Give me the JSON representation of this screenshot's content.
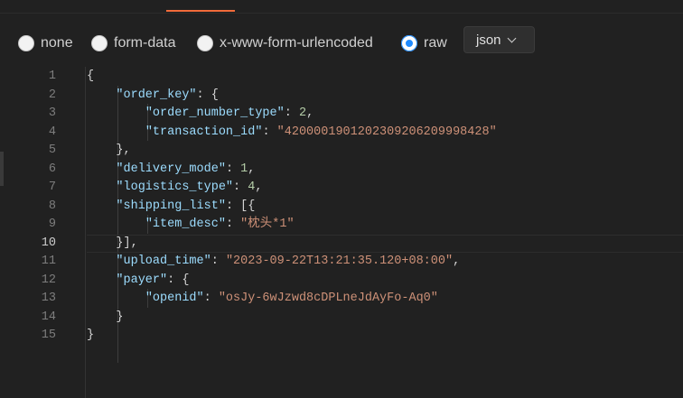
{
  "body_modes": {
    "options": [
      {
        "label": "none",
        "selected": false
      },
      {
        "label": "form-data",
        "selected": false
      },
      {
        "label": "x-www-form-urlencoded",
        "selected": false
      },
      {
        "label": "raw",
        "selected": true
      }
    ],
    "format_select": {
      "value": "json",
      "icon": "chevron-down-icon"
    }
  },
  "editor": {
    "active_line": 10,
    "lines": [
      {
        "no": "1",
        "tokens": [
          {
            "t": "p",
            "v": "{"
          }
        ]
      },
      {
        "no": "2",
        "tokens": [
          {
            "t": "p",
            "v": "    "
          },
          {
            "t": "k",
            "v": "\"order_key\""
          },
          {
            "t": "p",
            "v": ": {"
          }
        ]
      },
      {
        "no": "3",
        "tokens": [
          {
            "t": "p",
            "v": "        "
          },
          {
            "t": "k",
            "v": "\"order_number_type\""
          },
          {
            "t": "p",
            "v": ": "
          },
          {
            "t": "n",
            "v": "2"
          },
          {
            "t": "p",
            "v": ","
          }
        ]
      },
      {
        "no": "4",
        "tokens": [
          {
            "t": "p",
            "v": "        "
          },
          {
            "t": "k",
            "v": "\"transaction_id\""
          },
          {
            "t": "p",
            "v": ": "
          },
          {
            "t": "s",
            "v": "\"4200001901202309206209998428\""
          }
        ]
      },
      {
        "no": "5",
        "tokens": [
          {
            "t": "p",
            "v": "    },"
          }
        ]
      },
      {
        "no": "6",
        "tokens": [
          {
            "t": "p",
            "v": "    "
          },
          {
            "t": "k",
            "v": "\"delivery_mode\""
          },
          {
            "t": "p",
            "v": ": "
          },
          {
            "t": "n",
            "v": "1"
          },
          {
            "t": "p",
            "v": ","
          }
        ]
      },
      {
        "no": "7",
        "tokens": [
          {
            "t": "p",
            "v": "    "
          },
          {
            "t": "k",
            "v": "\"logistics_type\""
          },
          {
            "t": "p",
            "v": ": "
          },
          {
            "t": "n",
            "v": "4"
          },
          {
            "t": "p",
            "v": ","
          }
        ]
      },
      {
        "no": "8",
        "tokens": [
          {
            "t": "p",
            "v": "    "
          },
          {
            "t": "k",
            "v": "\"shipping_list\""
          },
          {
            "t": "p",
            "v": ": [{"
          }
        ]
      },
      {
        "no": "9",
        "tokens": [
          {
            "t": "p",
            "v": "        "
          },
          {
            "t": "k",
            "v": "\"item_desc\""
          },
          {
            "t": "p",
            "v": ": "
          },
          {
            "t": "s",
            "v": "\"枕头*1\""
          }
        ]
      },
      {
        "no": "10",
        "tokens": [
          {
            "t": "p",
            "v": "    }],"
          }
        ]
      },
      {
        "no": "11",
        "tokens": [
          {
            "t": "p",
            "v": "    "
          },
          {
            "t": "k",
            "v": "\"upload_time\""
          },
          {
            "t": "p",
            "v": ": "
          },
          {
            "t": "s",
            "v": "\"2023-09-22T13:21:35.120+08:00\""
          },
          {
            "t": "p",
            "v": ","
          }
        ]
      },
      {
        "no": "12",
        "tokens": [
          {
            "t": "p",
            "v": "    "
          },
          {
            "t": "k",
            "v": "\"payer\""
          },
          {
            "t": "p",
            "v": ": {"
          }
        ]
      },
      {
        "no": "13",
        "tokens": [
          {
            "t": "p",
            "v": "        "
          },
          {
            "t": "k",
            "v": "\"openid\""
          },
          {
            "t": "p",
            "v": ": "
          },
          {
            "t": "s",
            "v": "\"osJy-6wJzwd8cDPLneJdAyFo-Aq0\""
          }
        ]
      },
      {
        "no": "14",
        "tokens": [
          {
            "t": "p",
            "v": "    }"
          }
        ]
      },
      {
        "no": "15",
        "tokens": [
          {
            "t": "p",
            "v": "}"
          }
        ]
      }
    ]
  },
  "colors": {
    "background": "#212121",
    "accent_tab": "#f26b3a",
    "radio_selected": "#1f8bff",
    "json_key": "#9cdcfe",
    "json_string": "#ce9178",
    "json_number": "#b5cea8"
  }
}
